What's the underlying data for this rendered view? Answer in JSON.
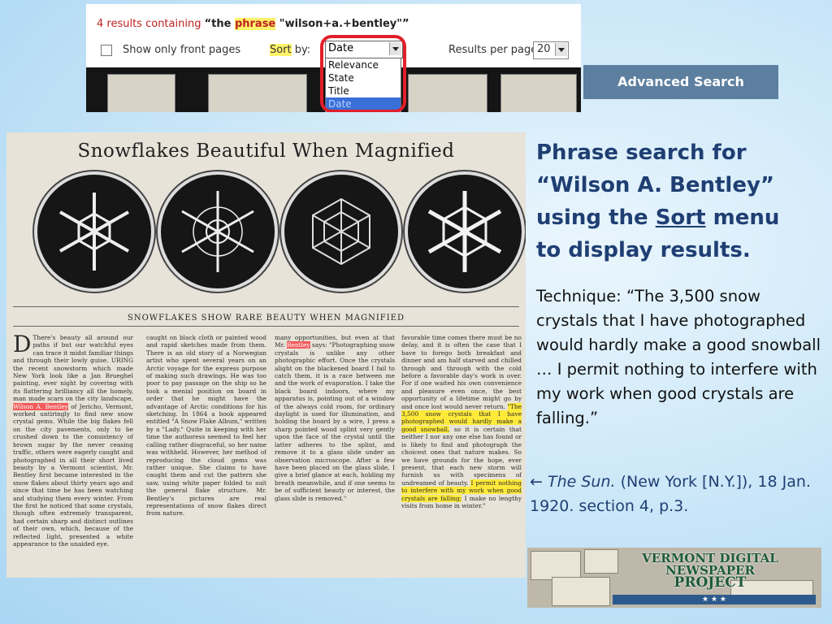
{
  "search_panel": {
    "results_prefix": "4 results containing",
    "query_open": "“the ",
    "query_phrase": "phrase",
    "query_rest": " \"wilson+a.+bentley\"”",
    "show_front_pages_label": "Show only front pages",
    "sort_by_label": "Sort",
    "sort_by_suffix": " by:",
    "sort_selected": "Date",
    "sort_options": [
      "Relevance",
      "State",
      "Title",
      "Date"
    ],
    "results_per_page_label": "Results per page:",
    "results_per_page_value": "20"
  },
  "advanced_search_label": "Advanced Search",
  "newspaper": {
    "headline": "Snowflakes  Beautiful  When  Magnified",
    "photo_caption": "SNOWFLAKES SHOW RARE BEAUTY WHEN MAGNIFIED"
  },
  "slide": {
    "title_line1": "Phrase search for",
    "title_line2": "“Wilson A. Bentley”",
    "title_line3_pre": "using the ",
    "title_line3_link": "Sort",
    "title_line3_post": " menu",
    "title_line4": "to display results.",
    "technique": "Technique: “The 3,500 snow crystals that I have photographed would hardly make a good snowball … I permit nothing to interfere with my work when good crystals are falling.”",
    "citation_arrow": "← ",
    "citation_source": "The Sun.",
    "citation_rest": " (New York [N.Y.]), 18 Jan. 1920. section 4, p.3."
  },
  "logo": {
    "line1": "VERMONT DIGITAL",
    "line2": "NEWSPAPER",
    "line3": "PROJECT"
  }
}
